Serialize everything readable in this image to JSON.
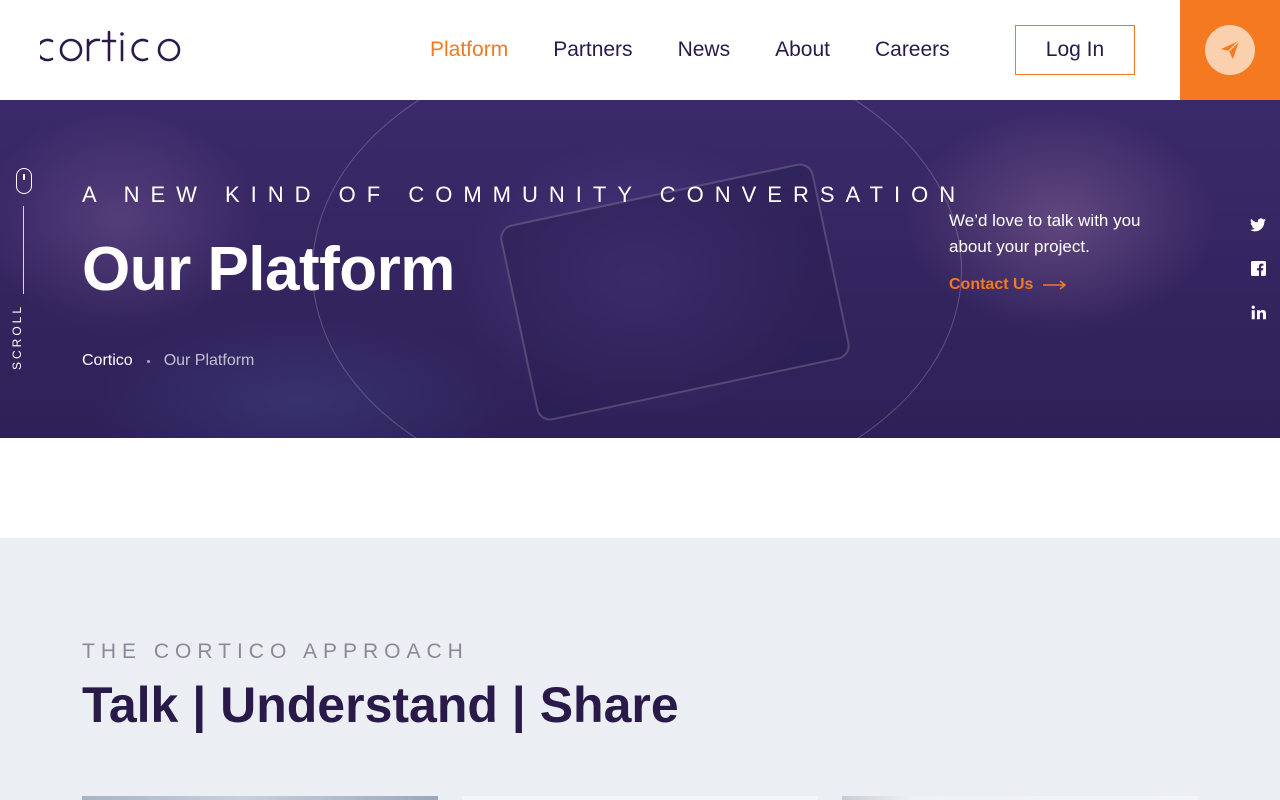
{
  "header": {
    "logo_text": "cortico",
    "nav": [
      {
        "label": "Platform",
        "active": true
      },
      {
        "label": "Partners",
        "active": false
      },
      {
        "label": "News",
        "active": false
      },
      {
        "label": "About",
        "active": false
      },
      {
        "label": "Careers",
        "active": false
      }
    ],
    "login_label": "Log In",
    "send_icon": "paper-plane-icon"
  },
  "hero": {
    "eyebrow": "A NEW KIND OF COMMUNITY CONVERSATION",
    "title": "Our Platform",
    "breadcrumb": {
      "home": "Cortico",
      "current": "Our Platform"
    },
    "scroll_label": "SCROLL",
    "cta_text": "We’d love to talk with you about your project.",
    "cta_link": "Contact Us",
    "social_icons": [
      "twitter-icon",
      "facebook-icon",
      "linkedin-icon"
    ]
  },
  "approach": {
    "eyebrow": "THE CORTICO APPROACH",
    "title": "Talk | Understand | Share"
  },
  "colors": {
    "accent": "#f47920",
    "brand_dark": "#2a1a4a",
    "section_bg": "#ebeff4"
  }
}
